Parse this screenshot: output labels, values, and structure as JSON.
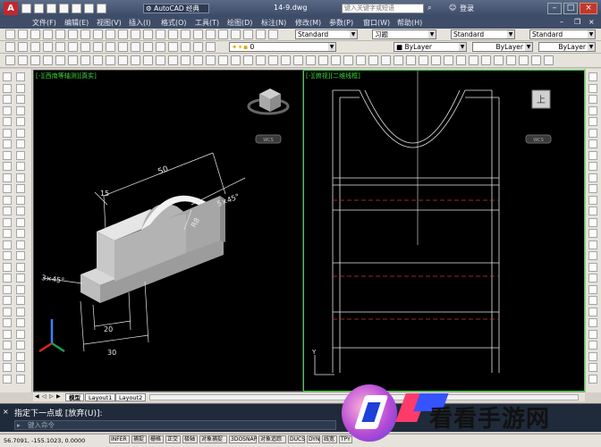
{
  "title_bar": {
    "workspace": "AutoCAD 经典",
    "file": "14-9.dwg",
    "search_placeholder": "键入关键字或短语",
    "login": "登录"
  },
  "menu": [
    "文件(F)",
    "编辑(E)",
    "视图(V)",
    "插入(I)",
    "格式(O)",
    "工具(T)",
    "绘图(D)",
    "标注(N)",
    "修改(M)",
    "参数(P)",
    "窗口(W)",
    "帮助(H)"
  ],
  "toolbar_styles": {
    "text_style": "Standard",
    "dim_style": "习题",
    "table_style": "Standard",
    "multileader_style": "Standard"
  },
  "layers_toolbar": {
    "layer_name": "0",
    "color": "ByLayer",
    "linetype": "ByLayer",
    "lineweight": "ByLayer"
  },
  "viewports": {
    "left_label": "[-][西南等轴测][真实]",
    "right_label": "[-][俯视][二维线框]",
    "left_viewcube_face": "",
    "right_viewcube_face": "上",
    "wcs_label": "WCS"
  },
  "dimensions": {
    "top_width": "50",
    "small_offset": "15",
    "chamfer_right": "5×45°",
    "radius": "R8",
    "chamfer_left": "3×45°",
    "bottom_inner": "20",
    "bottom_outer": "30"
  },
  "layout_tabs": [
    "模型",
    "Layout1",
    "Layout2"
  ],
  "command_line": {
    "prompt": "指定下一点或 [放弃(U)]:",
    "input_placeholder": "键入命令"
  },
  "status_bar": {
    "coords": "56.7091, -155.1023, 0.0000",
    "buttons": [
      "INFER",
      "捕捉",
      "栅格",
      "正交",
      "极轴",
      "对象捕捉",
      "3DOSNAP",
      "对象追踪",
      "DUCS",
      "DYN",
      "线宽",
      "TPY"
    ]
  },
  "watermark": "看看手游网"
}
